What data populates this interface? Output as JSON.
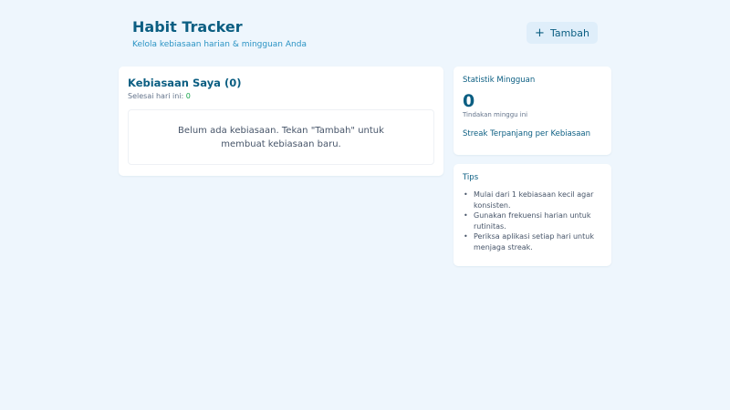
{
  "header": {
    "title": "Habit Tracker",
    "subtitle": "Kelola kebiasaan harian & mingguan Anda",
    "add_button_label": "Tambah",
    "add_button_icon": "plus-icon"
  },
  "habits": {
    "heading": "Kebiasaan Saya (0)",
    "done_today_label": "Selesai hari ini: ",
    "done_today_count": "0",
    "empty_message": "Belum ada kebiasaan. Tekan \"Tambah\" untuk membuat kebiasaan baru."
  },
  "stats": {
    "title": "Statistik Mingguan",
    "value": "0",
    "value_label": "Tindakan minggu ini",
    "streak_link": "Streak Terpanjang per Kebiasaan"
  },
  "tips": {
    "title": "Tips",
    "items": [
      "Mulai dari 1 kebiasaan kecil agar konsisten.",
      "Gunakan frekuensi harian untuk rutinitas.",
      "Periksa aplikasi setiap hari untuk menjaga streak."
    ]
  },
  "colors": {
    "background": "#eef6fd",
    "accent": "#0b5e82",
    "subtitle": "#2a93c4",
    "success": "#16a34a"
  }
}
